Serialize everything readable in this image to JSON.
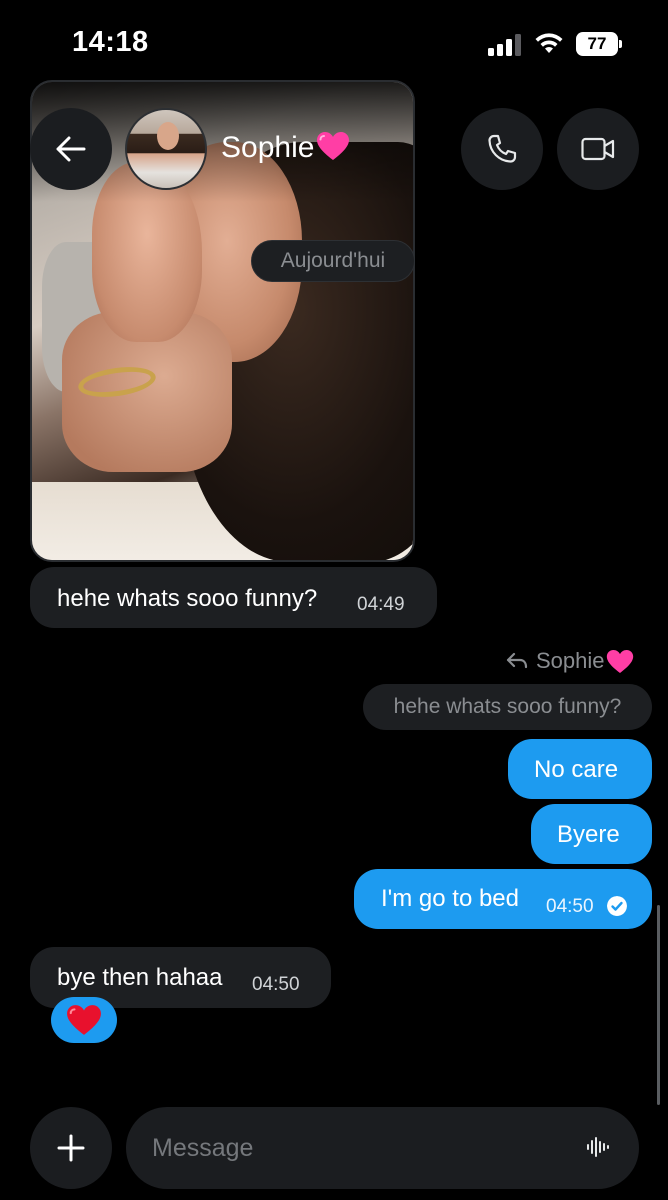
{
  "status_bar": {
    "time": "14:18",
    "battery": "77",
    "icons": [
      "signal-icon",
      "wifi-icon",
      "battery-icon"
    ]
  },
  "header": {
    "back_icon": "arrow-left-icon",
    "contact_name": "Sophie",
    "name_emoji": "pink-heart-icon",
    "call_icon": "phone-icon",
    "video_icon": "video-camera-icon"
  },
  "date_separator": "Aujourd'hui",
  "messages": [
    {
      "direction": "incoming",
      "type": "photo"
    },
    {
      "direction": "incoming",
      "text": "hehe whats sooo funny?",
      "time": "04:49"
    },
    {
      "direction": "outgoing",
      "reply_to_name": "Sophie",
      "reply_to_text": "hehe whats sooo funny?",
      "text": "No care"
    },
    {
      "direction": "outgoing",
      "text": "Byere"
    },
    {
      "direction": "outgoing",
      "text": "I'm go to bed",
      "time": "04:50",
      "status_icon": "check-circle-icon"
    },
    {
      "direction": "incoming",
      "text": "bye then hahaa",
      "time": "04:50",
      "reaction": "red-heart-icon"
    }
  ],
  "composer": {
    "add_icon": "plus-icon",
    "placeholder": "Message",
    "voice_icon": "voice-waveform-icon"
  },
  "colors": {
    "background": "#000000",
    "incoming_bubble": "#1d1f22",
    "outgoing_bubble": "#1d9bf0",
    "muted_text": "#8a8d91"
  }
}
